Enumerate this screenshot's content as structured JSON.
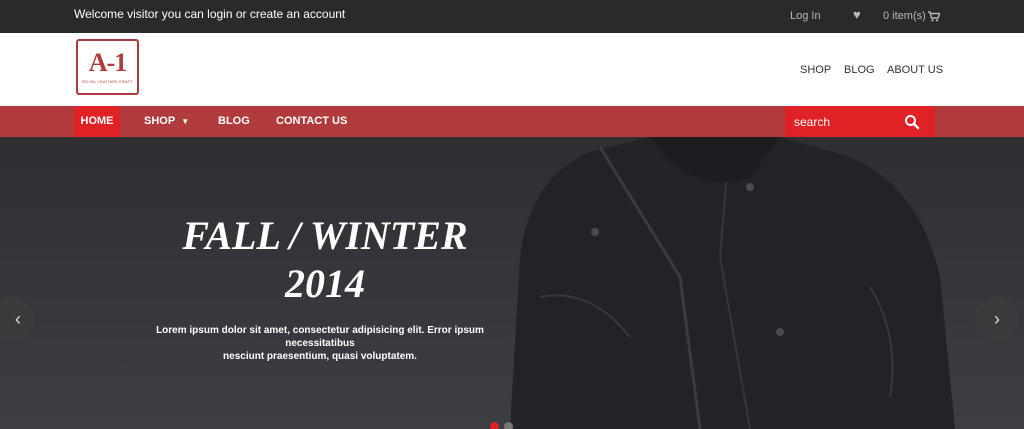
{
  "topbar": {
    "welcome": "Welcome visitor you can login or create an account",
    "login": "Log In",
    "heart_icon": "heart-icon",
    "cart": "0 item(s)",
    "cart_icon": "cart-icon"
  },
  "logo": {
    "mark": "A-1",
    "sub": "ROYAL LEATHER CRAFT"
  },
  "header_nav": [
    "SHOP",
    "BLOG",
    "ABOUT US"
  ],
  "main_nav": {
    "home": "HOME",
    "shop": "SHOP",
    "blog": "BLOG",
    "contact": "CONTACT US"
  },
  "search": {
    "placeholder": "search",
    "icon": "search-icon"
  },
  "hero": {
    "title_line1": "FALL / WINTER",
    "title_line2": "2014",
    "text_line1": "Lorem ipsum dolor sit amet, consectetur adipisicing elit. Error ipsum necessitatibus",
    "text_line2": "nesciunt praesentium, quasi voluptatem.",
    "prev": "‹",
    "next": "›"
  },
  "colors": {
    "accent": "#e02125",
    "nav": "#b13a3d",
    "topbar": "#2a2a2a"
  }
}
